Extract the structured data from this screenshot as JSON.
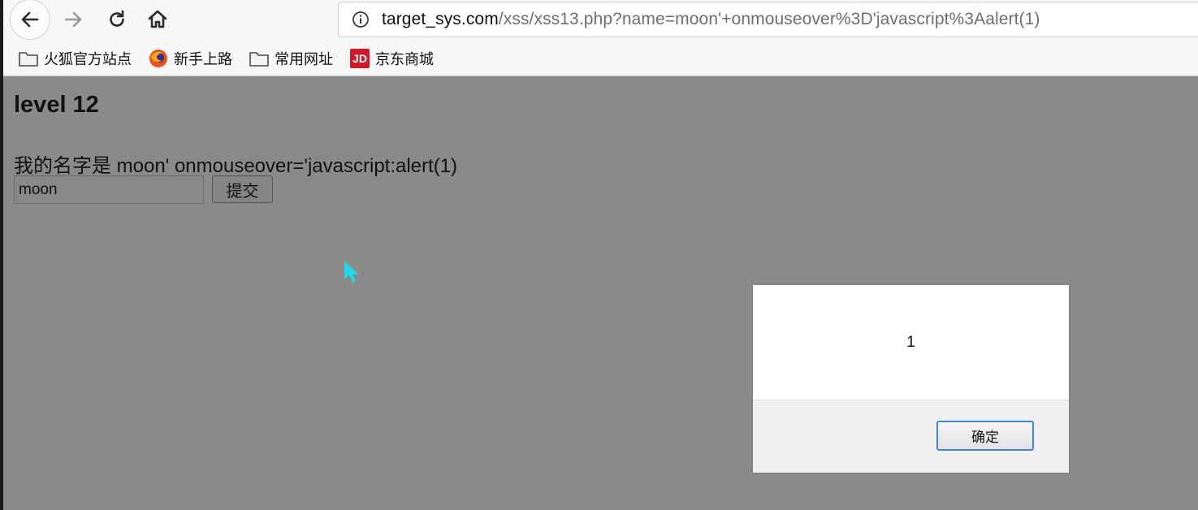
{
  "browser": {
    "url_host": "target_sys.com",
    "url_path": "/xss/xss13.php?name=moon'+onmouseover%3D'javascript%3Aalert(1)"
  },
  "bookmarks": [
    {
      "label": "火狐官方站点",
      "icon": "folder-icon"
    },
    {
      "label": "新手上路",
      "icon": "firefox-icon"
    },
    {
      "label": "常用网址",
      "icon": "folder-icon"
    },
    {
      "label": "京东商城",
      "icon": "jd-icon",
      "icon_text": "JD"
    }
  ],
  "page": {
    "title": "level 12",
    "name_line": "我的名字是 moon' onmouseover='javascript:alert(1)",
    "input_value": "moon",
    "submit_label": "提交"
  },
  "dialog": {
    "message": "1",
    "ok_label": "确定"
  },
  "colors": {
    "overlay_dim": "#8a8b89",
    "jd_brand": "#d0182b",
    "focus_ring": "#3c88d4",
    "cursor": "#20d8e8"
  }
}
